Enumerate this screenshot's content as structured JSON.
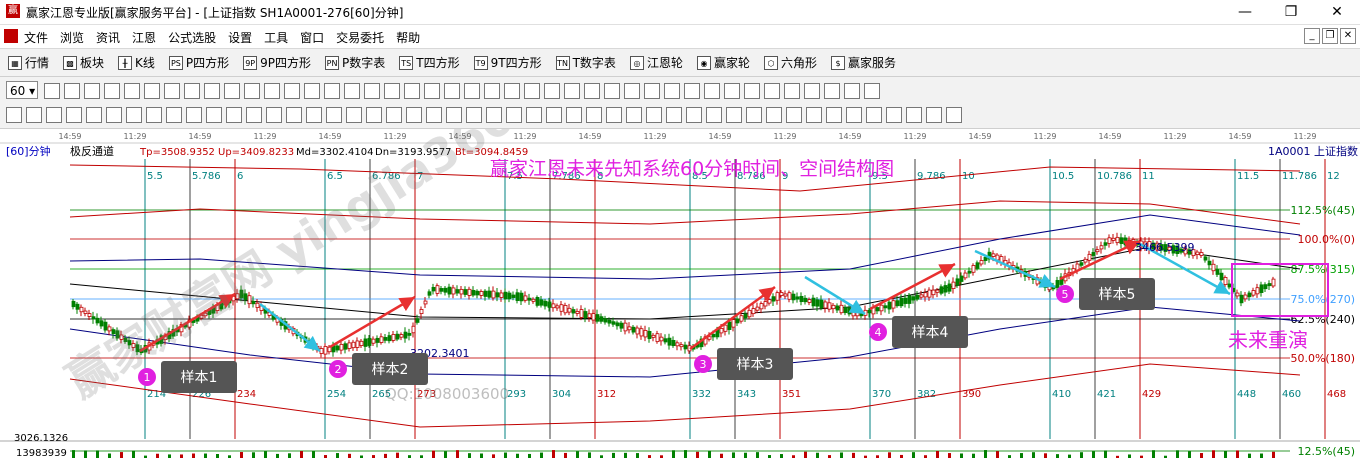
{
  "window": {
    "title": "赢家江恩专业版[赢家服务平台] - [上证指数  SH1A0001-276[60]分钟]",
    "minimize": "—",
    "restore": "❐",
    "close": "✕"
  },
  "menubar": {
    "items": [
      "文件",
      "浏览",
      "资讯",
      "江恩",
      "公式选股",
      "设置",
      "工具",
      "窗口",
      "交易委托",
      "帮助"
    ]
  },
  "toolbar1": {
    "items": [
      {
        "label": "行情",
        "icon": "grid-icon",
        "glyph": "▦"
      },
      {
        "label": "板块",
        "icon": "blocks-icon",
        "glyph": "▩"
      },
      {
        "label": "K线",
        "icon": "kline-icon",
        "glyph": "╫"
      },
      {
        "label": "P四方形",
        "icon": "ps-icon",
        "glyph": "PS"
      },
      {
        "label": "9P四方形",
        "icon": "9p-icon",
        "glyph": "9P"
      },
      {
        "label": "P数字表",
        "icon": "pn-icon",
        "glyph": "PN"
      },
      {
        "label": "T四方形",
        "icon": "ts-icon",
        "glyph": "TS"
      },
      {
        "label": "9T四方形",
        "icon": "9t-icon",
        "glyph": "T9"
      },
      {
        "label": "T数字表",
        "icon": "tn-icon",
        "glyph": "TN"
      },
      {
        "label": "江恩轮",
        "icon": "gann-wheel-icon",
        "glyph": "◎"
      },
      {
        "label": "赢家轮",
        "icon": "winner-wheel-icon",
        "glyph": "◉"
      },
      {
        "label": "六角形",
        "icon": "hexagon-icon",
        "glyph": "⬡"
      },
      {
        "label": "赢家服务",
        "icon": "dollar-icon",
        "glyph": "$"
      }
    ]
  },
  "toolbar2": {
    "period": "60",
    "tool_count": 42
  },
  "toolbar3": {
    "tool_count": 48
  },
  "chart_header": {
    "period_label": "[60]分钟",
    "indicator": "极反通道",
    "tp": "Tp=3508.9352",
    "up": "Up=3409.8233",
    "md": "Md=3302.4104",
    "dn": "Dn=3193.9577",
    "bt": "Bt=3094.8459",
    "symbol": "1A0001  上证指数",
    "headline": "赢家江恩未来先知系统60分钟时间、空间结构图",
    "watermark": "赢家财富网 yingjia360.com",
    "qq": "QQ:1008003600",
    "low_label": "3202.3401",
    "high_label": "3466.5399",
    "future_label": "未来重演",
    "left_value": "3026.1326",
    "left_value2": "13983939"
  },
  "time_ticks": [
    "14:59",
    "11:29",
    "14:59",
    "11:29",
    "14:59",
    "11:29",
    "14:59",
    "11:29",
    "14:59",
    "11:29",
    "14:59",
    "11:29",
    "14:59",
    "11:29",
    "14:59",
    "11:29",
    "14:59",
    "11:29",
    "14:59",
    "11:29"
  ],
  "top_cycle_labels": [
    "5.5",
    "5.786",
    "6",
    "6.5",
    "6.786",
    "7",
    "7.5",
    "7.786",
    "8",
    "8.5",
    "8.786",
    "9",
    "9.5",
    "9.786",
    "10",
    "10.5",
    "10.786",
    "11",
    "11.5",
    "11.786",
    "12"
  ],
  "bottom_cycle_labels": [
    "214",
    "226",
    "234",
    "254",
    "265",
    "273",
    "293",
    "304",
    "312",
    "332",
    "343",
    "351",
    "370",
    "382",
    "390",
    "410",
    "421",
    "429",
    "448",
    "460",
    "468"
  ],
  "pct_levels": [
    {
      "label": "112.5%(45)",
      "color": "#008000"
    },
    {
      "label": "100.0%(0)",
      "color": "#c00000"
    },
    {
      "label": "87.5%(315)",
      "color": "#00a000"
    },
    {
      "label": "75.0%(270)",
      "color": "#40a0ff"
    },
    {
      "label": "62.5%(240)",
      "color": "#000000"
    },
    {
      "label": "50.0%(180)",
      "color": "#c00000"
    },
    {
      "label": "12.5%(45)",
      "color": "#008000"
    }
  ],
  "samples": [
    {
      "num": "1",
      "label": "样本1"
    },
    {
      "num": "2",
      "label": "样本2"
    },
    {
      "num": "3",
      "label": "样本3"
    },
    {
      "num": "4",
      "label": "样本4"
    },
    {
      "num": "5",
      "label": "样本5"
    }
  ],
  "colors": {
    "up_candle": "#c00000",
    "down_candle": "#008000",
    "arrow_red": "#e83030",
    "arrow_cyan": "#30c0e0",
    "marker": "#e020e0",
    "headline": "#e020e0",
    "channel_red": "#c00000",
    "channel_blue": "#000080",
    "channel_black": "#000000"
  }
}
